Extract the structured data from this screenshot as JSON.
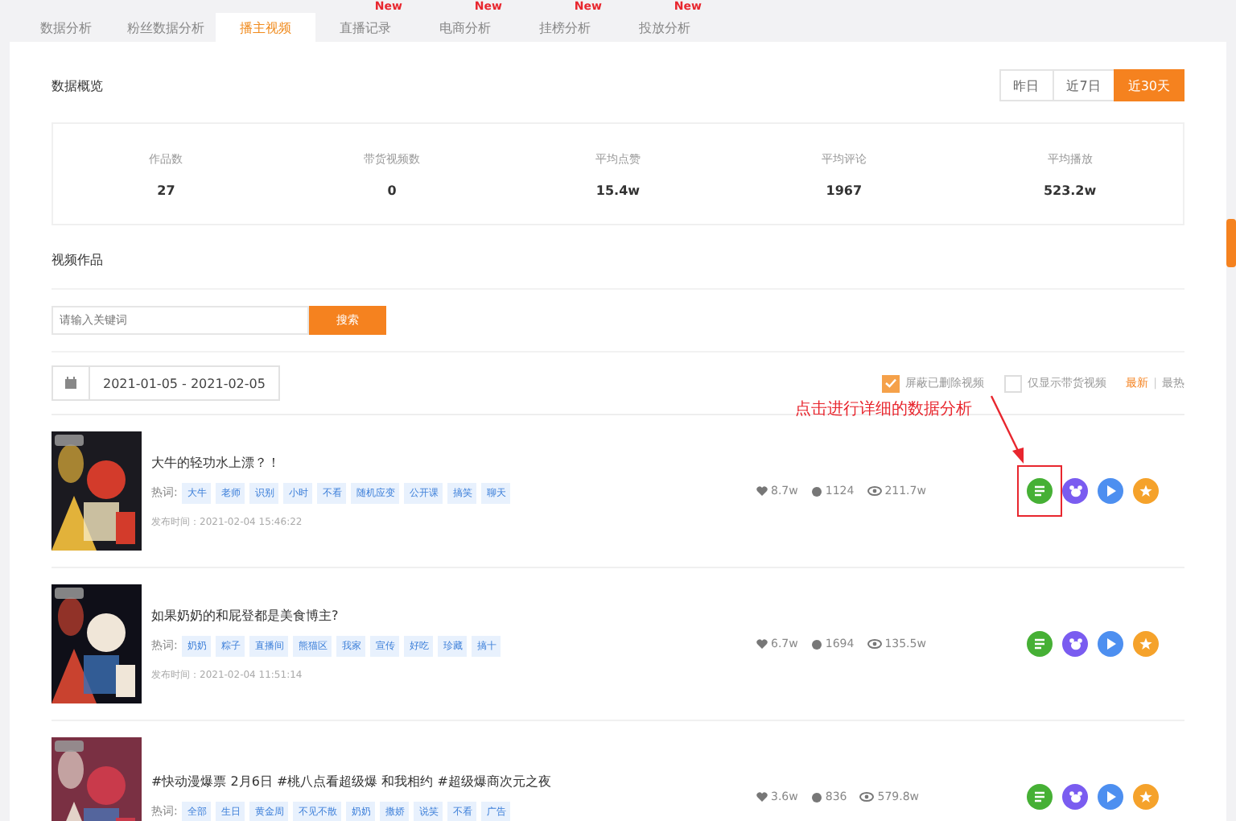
{
  "tabs": [
    {
      "label": "数据分析",
      "selected": false
    },
    {
      "label": "粉丝数据分析",
      "selected": false
    },
    {
      "label": "播主视频",
      "selected": true
    },
    {
      "label": "直播记录",
      "selected": false,
      "badge": "New"
    },
    {
      "label": "电商分析",
      "selected": false,
      "badge": "New"
    },
    {
      "label": "挂榜分析",
      "selected": false,
      "badge": "New"
    },
    {
      "label": "投放分析",
      "selected": false,
      "badge": "New"
    }
  ],
  "overview": {
    "title": "数据概览",
    "ranges": [
      {
        "label": "昨日",
        "selected": false
      },
      {
        "label": "近7日",
        "selected": false
      },
      {
        "label": "近30天",
        "selected": true
      }
    ],
    "stats": [
      {
        "label": "作品数",
        "value": "27"
      },
      {
        "label": "带货视频数",
        "value": "0"
      },
      {
        "label": "平均点赞",
        "value": "15.4w"
      },
      {
        "label": "平均评论",
        "value": "1967"
      },
      {
        "label": "平均播放",
        "value": "523.2w"
      }
    ]
  },
  "videos_section": {
    "title": "视频作品",
    "search": {
      "placeholder": "请输入关键词",
      "button": "搜索"
    },
    "date_range": "2021-01-05 - 2021-02-05",
    "filters": [
      {
        "label": "屏蔽已删除视频",
        "checked": true
      },
      {
        "label": "仅显示带货视频",
        "checked": false
      }
    ],
    "sorts": [
      {
        "label": "最新",
        "selected": true
      },
      {
        "label": "最热",
        "selected": false
      }
    ],
    "sort_separator": "|",
    "annotation": "点击进行详细的数据分析",
    "videos": [
      {
        "title": "大牛的轻功水上漂？！",
        "tag_label": "热词:",
        "tags": [
          "大牛",
          "老师",
          "识别",
          "小时",
          "不看",
          "随机应变",
          "公开课",
          "搞笑",
          "聊天"
        ],
        "published": "发布时间：2021-02-04 15:46:22",
        "likes": "8.7w",
        "comments": "1124",
        "views": "211.7w",
        "highlighted": true
      },
      {
        "title": "如果奶奶的和屁登都是美食博主?",
        "tag_label": "热词:",
        "tags": [
          "奶奶",
          "粽子",
          "直播间",
          "熊猫区",
          "我家",
          "宣传",
          "好吃",
          "珍藏",
          "搞十"
        ],
        "published": "发布时间：2021-02-04 11:51:14",
        "likes": "6.7w",
        "comments": "1694",
        "views": "135.5w",
        "highlighted": false
      },
      {
        "title": "#快动漫爆票 2月6日 #桃八点看超级爆 和我相约 #超级爆商次元之夜",
        "tag_label": "热词:",
        "tags": [
          "全部",
          "生日",
          "黄金周",
          "不见不散",
          "奶奶",
          "撒娇",
          "说笑",
          "不看",
          "广告"
        ],
        "likes": "3.6w",
        "comments": "836",
        "views": "579.8w",
        "highlighted": false
      }
    ]
  }
}
